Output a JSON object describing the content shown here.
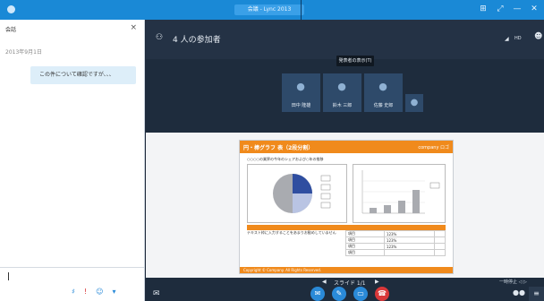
{
  "titlebar": {
    "title": "会議 - Lync 2013",
    "buttons": [
      "⊞",
      "⤢",
      "—",
      "✕"
    ]
  },
  "chat_panel": {
    "title": "会話",
    "date": "2013年9月1日",
    "message": "この件について確認ですが、、、"
  },
  "header": {
    "participants": "4 人の参加者",
    "quality": "HD"
  },
  "tooltip": "発表者の表示(T)",
  "participants": [
    {
      "name": "田中 隆雄"
    },
    {
      "name": "鈴木 三郎"
    },
    {
      "name": "佐藤 史郎"
    }
  ],
  "slide": {
    "title": "円・棒グラフ 表（2段分割）",
    "brand": "company ロゴ",
    "subtitle": "○○○○の業界の今年のシェアおよび○年の推移",
    "side_text": "テキスト枠に入力することをあまりお勧めしていません",
    "footer": "Copyright © Company. All Rights Reserved.",
    "table_rows": [
      [
        "項目",
        "123%"
      ],
      [
        "項目",
        "123%"
      ],
      [
        "項目",
        "123%"
      ],
      [
        "項目",
        ""
      ]
    ]
  },
  "pager": {
    "text": "スライド 1/1",
    "right": "一時停止 ◁ ▷"
  },
  "colors": {
    "accent_orange": "#f08a1c",
    "pie_blue": "#2f4ea0",
    "pie_gray": "#a9abb0",
    "hangup_red": "#d9383a",
    "call_blue": "#2a8ad8"
  }
}
